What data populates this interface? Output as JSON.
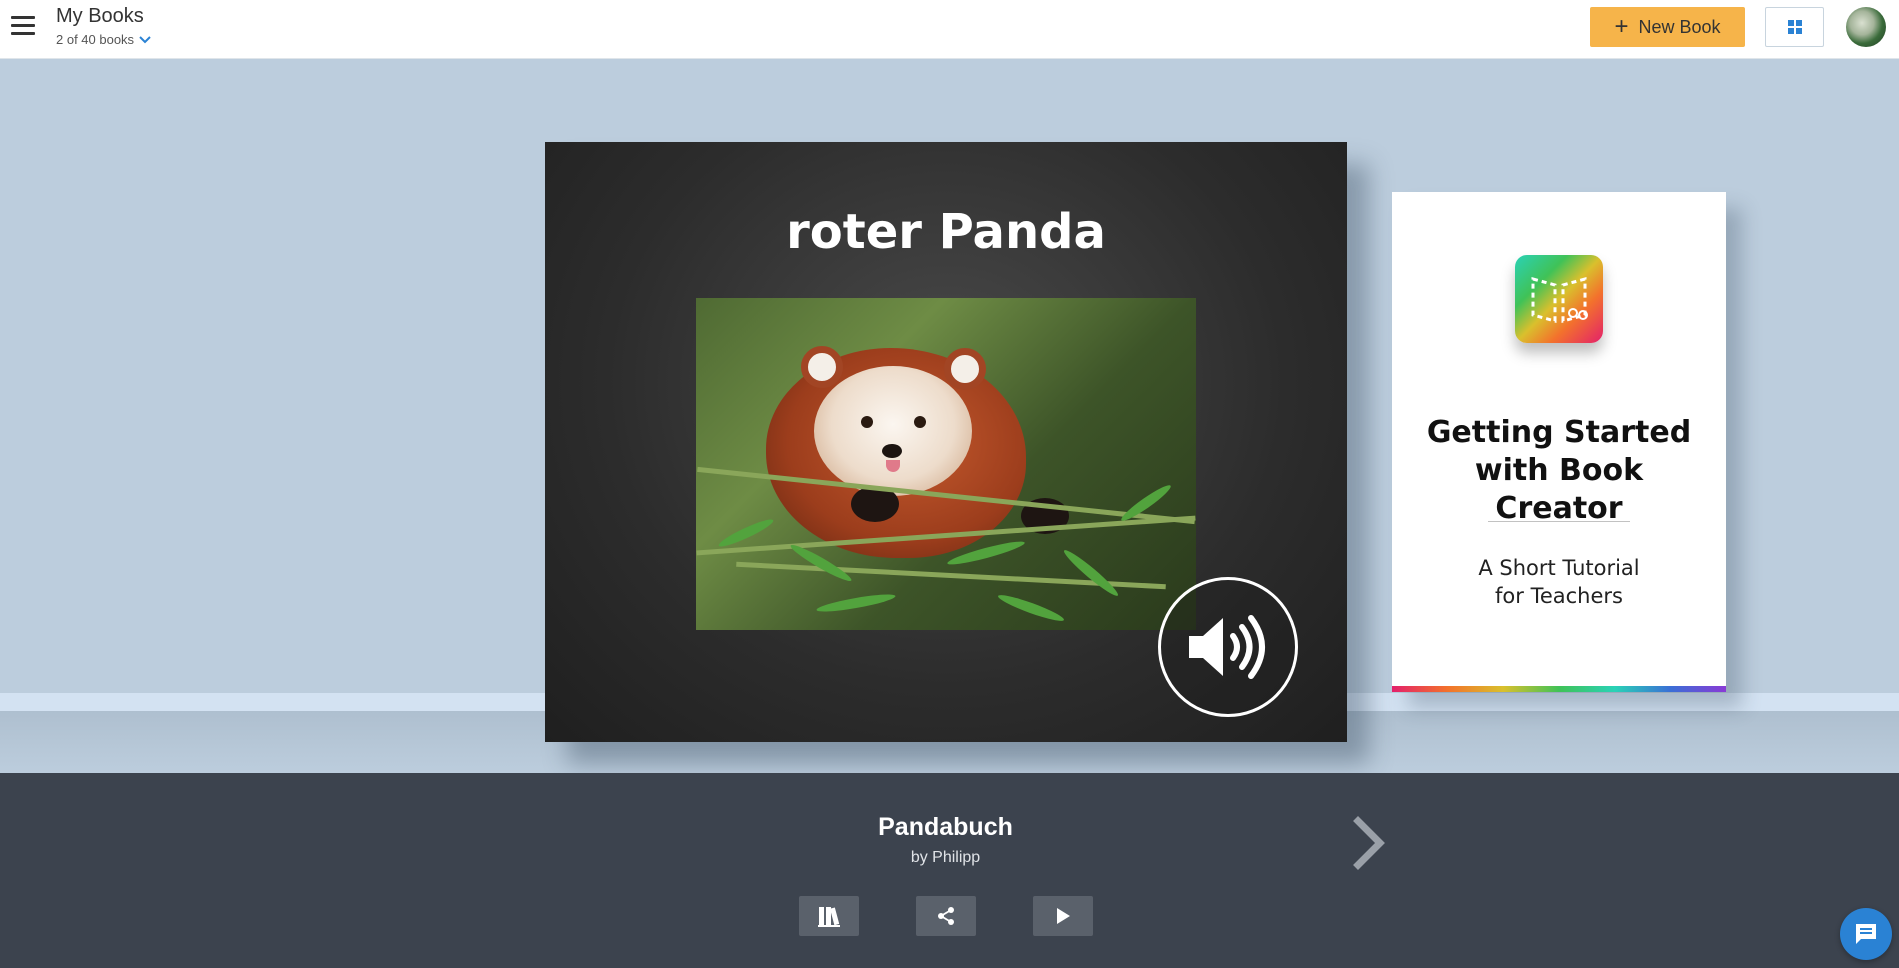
{
  "header": {
    "title": "My Books",
    "book_count": "2 of 40 books",
    "new_book_label": "New Book",
    "icons": {
      "menu": "hamburger-icon",
      "dropdown": "chevron-down-icon",
      "plus": "plus-icon",
      "view": "grid-view-icon"
    }
  },
  "shelf": {
    "current_book": {
      "cover_title": "roter Panda",
      "name": "Pandabuch",
      "author": "by Philipp",
      "sound_icon": "speaker-icon"
    },
    "next_book": {
      "title": "Getting Started with Book Creator",
      "subtitle": "A Short Tutorial for Teachers",
      "logo_icon": "book-creator-logo"
    }
  },
  "actions": {
    "icons": [
      "library-icon",
      "share-icon",
      "play-icon"
    ]
  },
  "navigation": {
    "next_icon": "chevron-right-icon"
  },
  "support": {
    "chat_icon": "chat-icon"
  },
  "colors": {
    "accent_orange": "#f6b44a",
    "link_blue": "#2a82d4",
    "shelf_bg": "#bccddd",
    "bottom_panel": "#3c434e"
  }
}
